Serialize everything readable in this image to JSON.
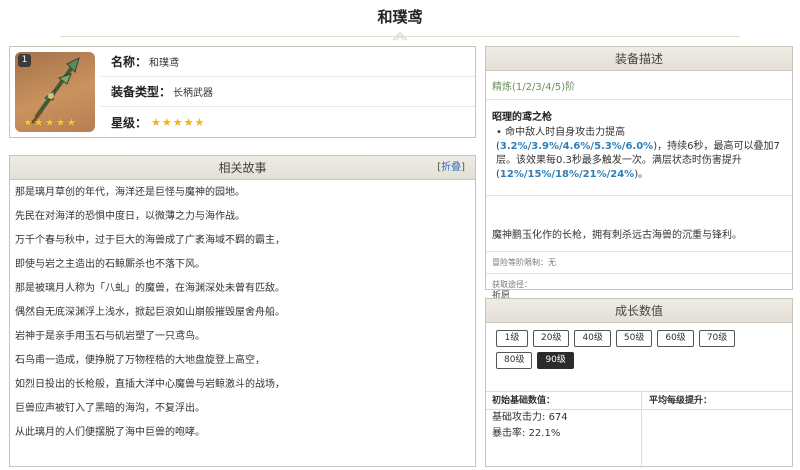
{
  "page": {
    "title": "和璞鸢"
  },
  "info": {
    "rarity_badge": "1",
    "art_stars": "★★★★★",
    "rows": [
      {
        "label": "名称：",
        "value": "和璞鸢"
      },
      {
        "label": "装备类型：",
        "value": "长柄武器"
      },
      {
        "label": "星级：",
        "value": "★★★★★"
      }
    ]
  },
  "story": {
    "title": "相关故事",
    "collapse_prefix": "[",
    "collapse_label": "折叠",
    "collapse_suffix": "]",
    "lines": [
      "那是璃月草创的年代，海洋还是巨怪与魔神的园地。",
      "先民在对海洋的恐惧中度日，以微薄之力与海作战。",
      "万千个春与秋中，过于巨大的海兽成了广袤海域不羁的霸主，",
      "即使与岩之主造出的石鲸厮杀也不落下风。",
      "那是被璃月人称为「八虬」的魔兽，在海渊深处未曾有匹敌。",
      "偶然自无底深渊浮上浅水，掀起巨浪如山崩般摧毁屋舍舟船。",
      "岩神于是亲手用玉石与矶岩塑了一只鸢鸟。",
      "石鸟甫一造成，便挣脱了万物桎梏的大地盘旋登上高空，",
      "如烈日投出的长枪般，直插大洋中心魔兽与岩鲸激斗的战场，",
      "巨兽应声被钉入了黑暗的海沟，不复浮出。",
      "从此璃月的人们便摆脱了海中巨兽的咆哮。"
    ]
  },
  "description": {
    "title": "装备描述",
    "refine": "精炼(1/2/3/4/5)阶",
    "skill_name": "昭理的鸢之枪",
    "skill_bullet": "•",
    "skill_p1": " 命中敌人时自身攻击力提高(",
    "skill_v1": "3.2%/3.9%/4.6%/5.3%/6.0%",
    "skill_p2": ")，持续6秒，最高可以叠加7层。该效果每0.3秒最多触发一次。满层状态时伤害提升(",
    "skill_v2": "12%/15%/18%/21%/24%",
    "skill_p3": ")。",
    "flavor": "魔神鹏玉化作的长枪，拥有刺杀远古海兽的沉重与锋利。",
    "limit": "冒险等阶限制：无",
    "obtain_label": "获取途径：",
    "obtain_value": "祈愿"
  },
  "growth": {
    "title": "成长数值",
    "levels": [
      "1级",
      "20级",
      "40级",
      "50级",
      "60级",
      "70级",
      "80级",
      "90级"
    ],
    "active_level": "90级",
    "base_header": "初始基础数值：",
    "avg_header": "平均每级提升：",
    "stats": [
      {
        "label": "基础攻击力:",
        "value": "674"
      },
      {
        "label": "暴击率:",
        "value": "22.1%"
      }
    ]
  },
  "colors": {
    "refine": "#6d8f62",
    "highlight": "#2e7fb8",
    "link": "#2e6fba",
    "star": "#f2b21c"
  }
}
